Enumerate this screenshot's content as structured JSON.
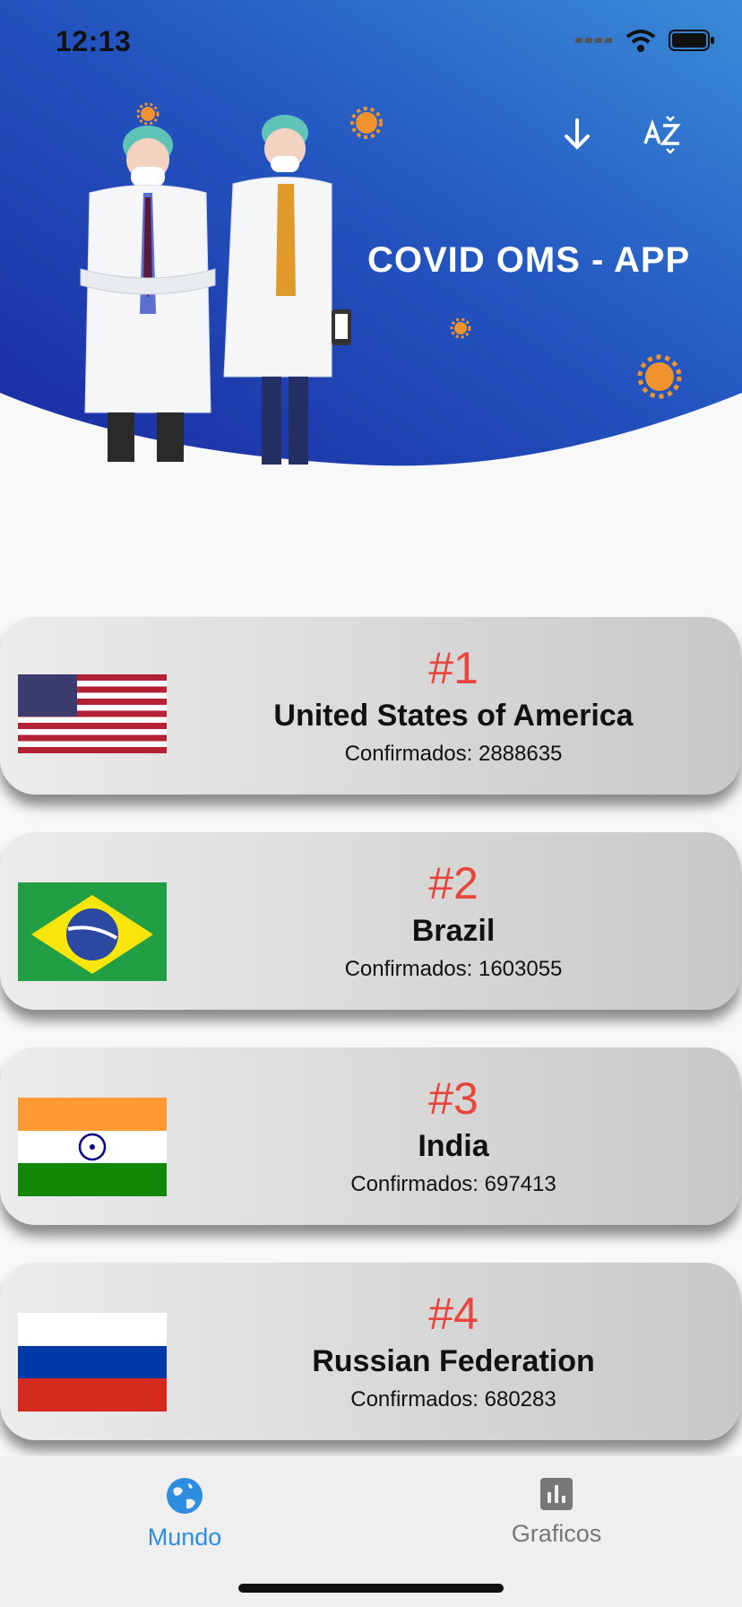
{
  "status_bar": {
    "time": "12:13"
  },
  "header": {
    "title": "COVID OMS - APP",
    "sort_icon": "arrow-down-icon",
    "alpha_sort_icon": "sort-az-icon",
    "gradient_start": "#1a2fa8",
    "gradient_end": "#3a86d6"
  },
  "countries": [
    {
      "rank": "#1",
      "name": "United States of America",
      "confirmed": "Confirmados: 2888635",
      "flag": "usa-flag-icon"
    },
    {
      "rank": "#2",
      "name": "Brazil",
      "confirmed": "Confirmados: 1603055",
      "flag": "brazil-flag-icon"
    },
    {
      "rank": "#3",
      "name": "India",
      "confirmed": "Confirmados: 697413",
      "flag": "india-flag-icon"
    },
    {
      "rank": "#4",
      "name": "Russian Federation",
      "confirmed": "Confirmados: 680283",
      "flag": "russia-flag-icon"
    }
  ],
  "nav": {
    "items": [
      {
        "label": "Mundo",
        "icon": "globe-icon",
        "active": true
      },
      {
        "label": "Graficos",
        "icon": "bar-chart-icon",
        "active": false
      }
    ],
    "active_color": "#2f8de0",
    "inactive_color": "#777777"
  }
}
